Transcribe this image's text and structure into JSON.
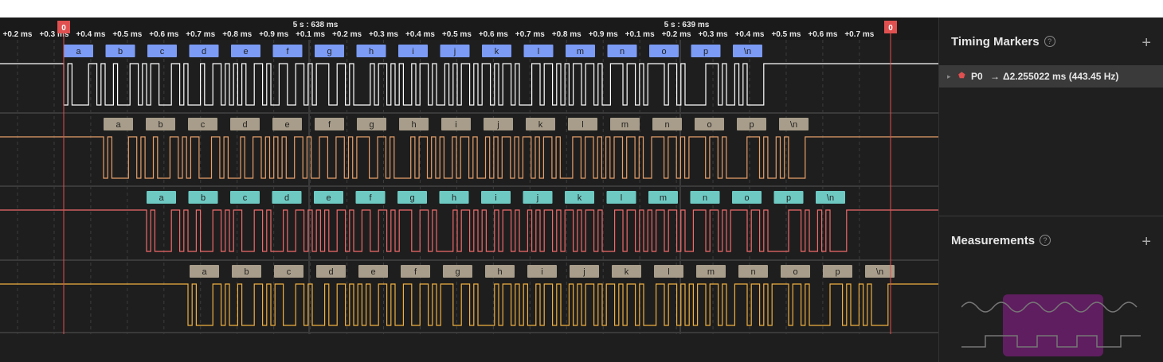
{
  "ruler": {
    "ticks": [
      "+0.2 ms",
      "+0.3 ms",
      "+0.4 ms",
      "+0.5 ms",
      "+0.6 ms",
      "+0.7 ms",
      "+0.8 ms",
      "+0.9 ms",
      "+0.1 ms",
      "+0.2 ms",
      "+0.3 ms",
      "+0.4 ms",
      "+0.5 ms",
      "+0.6 ms",
      "+0.7 ms",
      "+0.8 ms",
      "+0.9 ms",
      "+0.1 ms",
      "+0.2 ms",
      "+0.3 ms",
      "+0.4 ms",
      "+0.5 ms",
      "+0.6 ms",
      "+0.7 ms"
    ],
    "major_labels": [
      "5 s : 638 ms",
      "5 s : 639 ms"
    ],
    "marker_flag": "0"
  },
  "channels": [
    {
      "color": "#ffffff",
      "label_bg": "#7b9bf5",
      "labels": [
        "a",
        "b",
        "c",
        "d",
        "e",
        "f",
        "g",
        "h",
        "i",
        "j",
        "k",
        "l",
        "m",
        "n",
        "o",
        "p",
        "\\n"
      ]
    },
    {
      "color": "#e8a06a",
      "label_bg": "#a89d8a",
      "labels": [
        "a",
        "b",
        "c",
        "d",
        "e",
        "f",
        "g",
        "h",
        "i",
        "j",
        "k",
        "l",
        "m",
        "n",
        "o",
        "p",
        "\\n"
      ]
    },
    {
      "color": "#f06a6a",
      "label_bg": "#6ec9c3",
      "labels": [
        "a",
        "b",
        "c",
        "d",
        "e",
        "f",
        "g",
        "h",
        "i",
        "j",
        "k",
        "l",
        "m",
        "n",
        "o",
        "p",
        "\\n"
      ]
    },
    {
      "color": "#f0b040",
      "label_bg": "#a89d8a",
      "labels": [
        "a",
        "b",
        "c",
        "d",
        "e",
        "f",
        "g",
        "h",
        "i",
        "j",
        "k",
        "l",
        "m",
        "n",
        "o",
        "p",
        "\\n"
      ]
    }
  ],
  "timing_markers": {
    "title": "Timing Markers",
    "help": "?",
    "add": "+",
    "row": {
      "name": "P0",
      "arrow": "→",
      "value": "Δ2.255022 ms (443.45 Hz)"
    }
  },
  "measurements": {
    "title": "Measurements",
    "help": "?",
    "add": "+"
  },
  "colors": {
    "marker": "#e05050",
    "background": "#1e1e1e",
    "grid": "#3a3a3a",
    "highlight": "#6b1f6b"
  }
}
